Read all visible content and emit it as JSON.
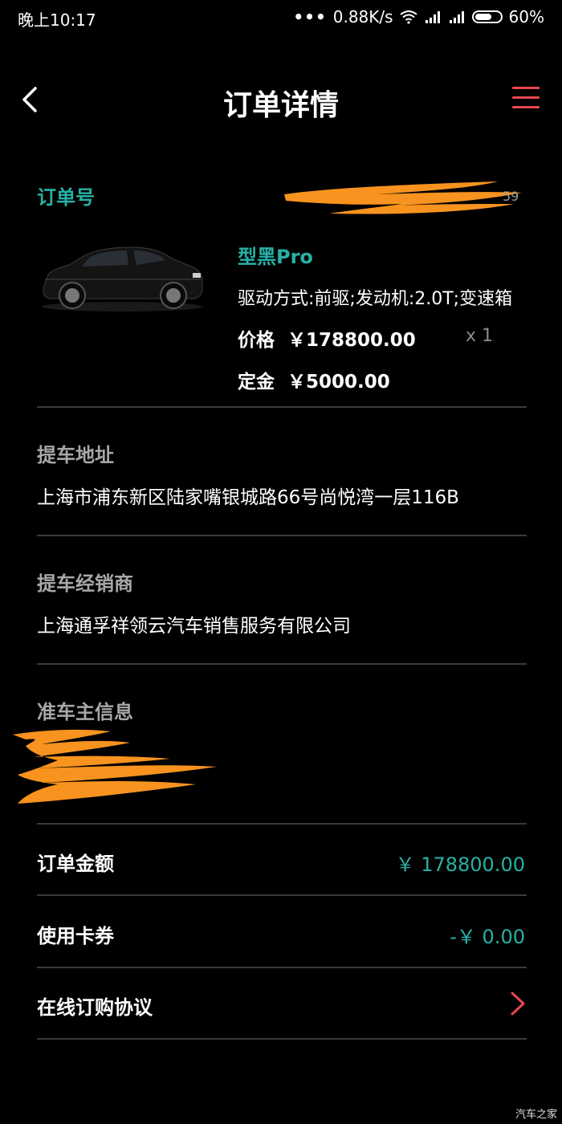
{
  "status_bar": {
    "time": "晚上10:17",
    "net_speed": "0.88K/s",
    "battery": "60%"
  },
  "nav": {
    "title": "订单详情"
  },
  "order": {
    "number_label": "订单号"
  },
  "product": {
    "name": "型黑Pro",
    "spec": "驱动方式:前驱;发动机:2.0T;变速箱",
    "price_label": "价格",
    "price": "￥178800.00",
    "quantity": "x 1",
    "deposit_label": "定金",
    "deposit": "￥5000.00"
  },
  "pickup_address": {
    "label": "提车地址",
    "value": "上海市浦东新区陆家嘴银城路66号尚悦湾一层116B"
  },
  "dealer": {
    "label": "提车经销商",
    "value": "上海通孚祥领云汽车销售服务有限公司"
  },
  "owner_info": {
    "label": "准车主信息"
  },
  "summary": {
    "order_amount_label": "订单金额",
    "order_amount": "￥ 178800.00",
    "coupon_label": "使用卡券",
    "coupon": "-￥ 0.00",
    "agreement_label": "在线订购协议"
  },
  "watermark": "汽车之家",
  "colors": {
    "accent_teal": "#27b1a6",
    "accent_red": "#e8474f",
    "redaction": "#f7931e",
    "background": "#000000"
  }
}
